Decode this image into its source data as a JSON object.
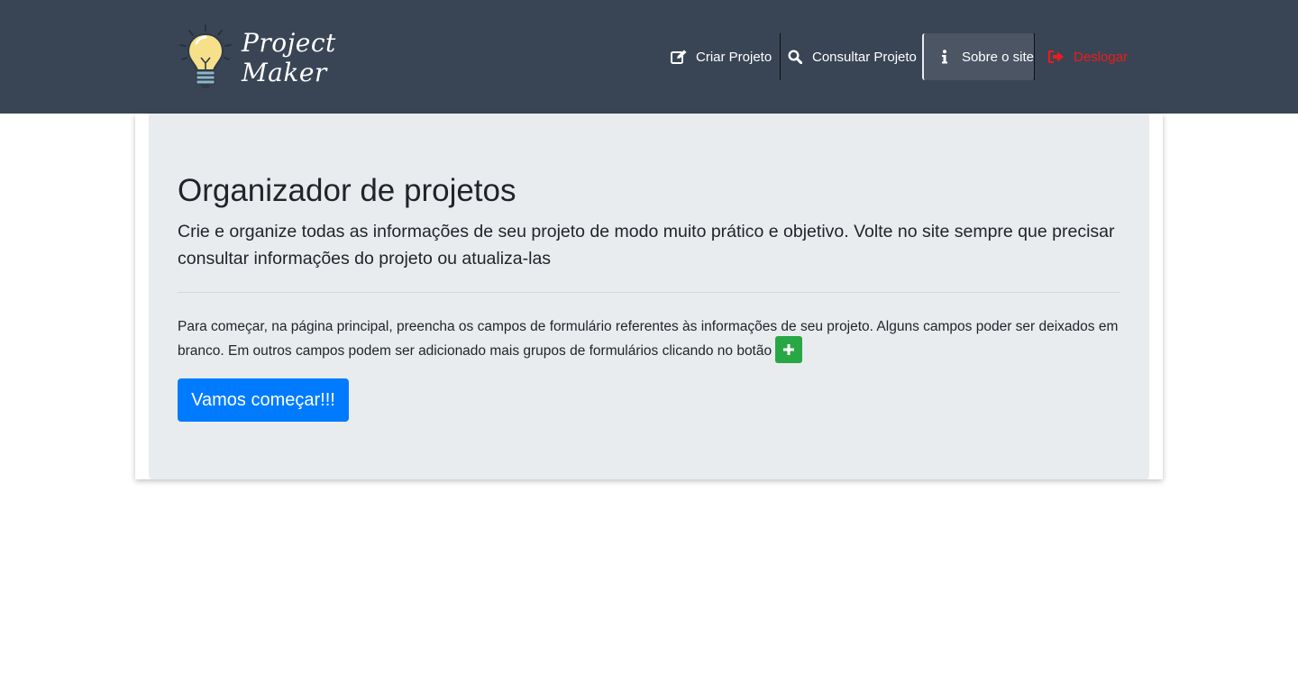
{
  "brand": {
    "line1": "Project",
    "line2": "Maker",
    "icon": "lightbulb-icon"
  },
  "nav": {
    "criar": {
      "label": "Criar Projeto",
      "icon": "edit-icon"
    },
    "consultar": {
      "label": "Consultar Projeto",
      "icon": "search-icon"
    },
    "sobre": {
      "label": "Sobre o site",
      "icon": "info-icon",
      "active": true
    },
    "deslogar": {
      "label": "Deslogar",
      "icon": "sign-out-icon"
    }
  },
  "main": {
    "title": "Organizador de projetos",
    "lead": "Crie e organize todas as informações de seu projeto de modo muito prático e objetivo. Volte no site sempre que precisar consultar informações do projeto ou atualiza-las",
    "text": "Para começar, na página principal, preencha os campos de formulário referentes às informações de seu projeto. Alguns campos poder ser deixados em branco. Em outros campos podem ser adicionado mais grupos de formulários clicando no botão",
    "plus_icon": "plus-icon",
    "button_label": "Vamos começar!!!"
  },
  "colors": {
    "navbar": "#394555",
    "logout": "#ee1b1b",
    "primary": "#007bff",
    "success": "#28a745",
    "jumbotron": "#e9ecef"
  }
}
